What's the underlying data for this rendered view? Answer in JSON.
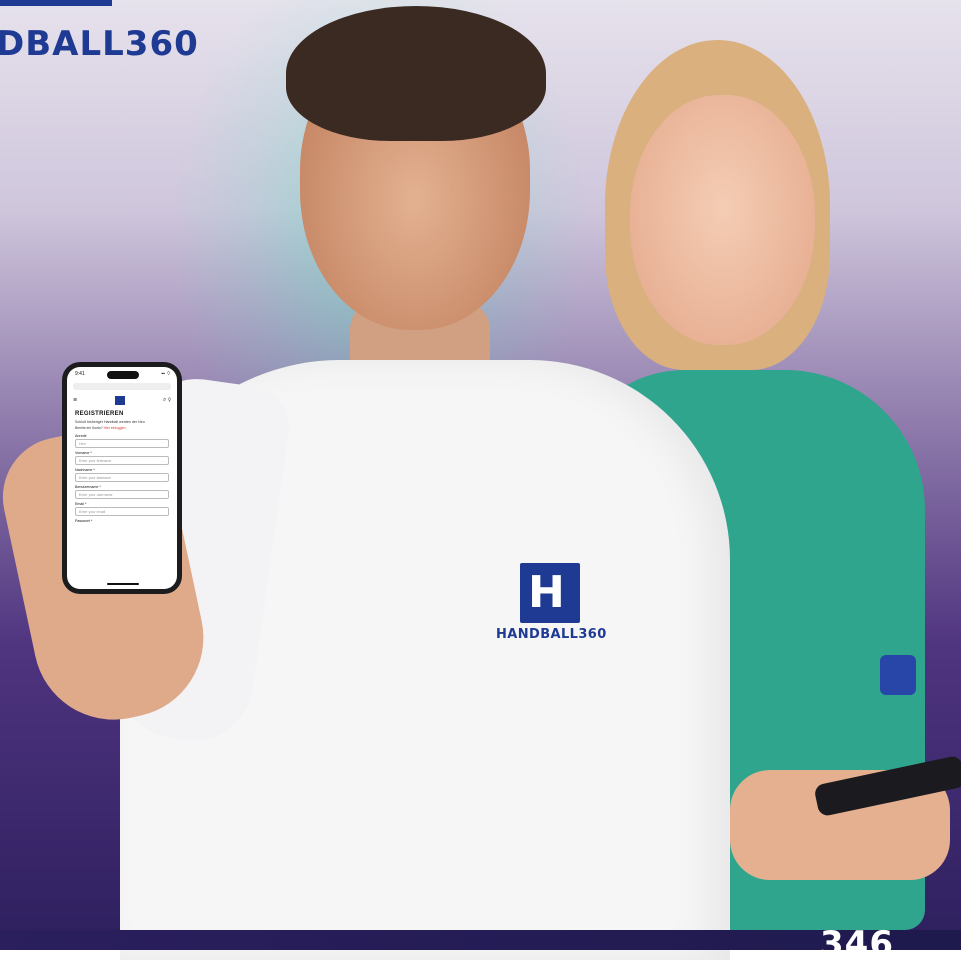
{
  "brand": {
    "top_left": "DBALL360",
    "shirt_logo_letter": "H",
    "shirt_text": "HANDBALL360",
    "bottom_right_partial": "346"
  },
  "phone": {
    "time": "9:41",
    "status": "▪▪ ⌔",
    "menu_glyph": "≡",
    "icons_glyph": "⌕ ⚲",
    "title": "REGISTRIEREN",
    "subtitle": "Schluß bisheriger Handball werden der Neu",
    "login_prefix": "Bereits ein Konto?",
    "login_link": "Hier einloggen",
    "fields": [
      {
        "label": "Anrede",
        "placeholder": "Herr"
      },
      {
        "label": "Vorname *",
        "placeholder": "Enter your firstname"
      },
      {
        "label": "Nachname *",
        "placeholder": "Enter your lastname"
      },
      {
        "label": "Benutzername *",
        "placeholder": "Enter your username"
      },
      {
        "label": "Email *",
        "placeholder": "Enter your email"
      },
      {
        "label": "Passwort *",
        "placeholder": ""
      }
    ]
  },
  "colors": {
    "brand_blue": "#1f3a93",
    "teal_jersey": "#2fa58d",
    "purple_bg": "#4f347f"
  }
}
